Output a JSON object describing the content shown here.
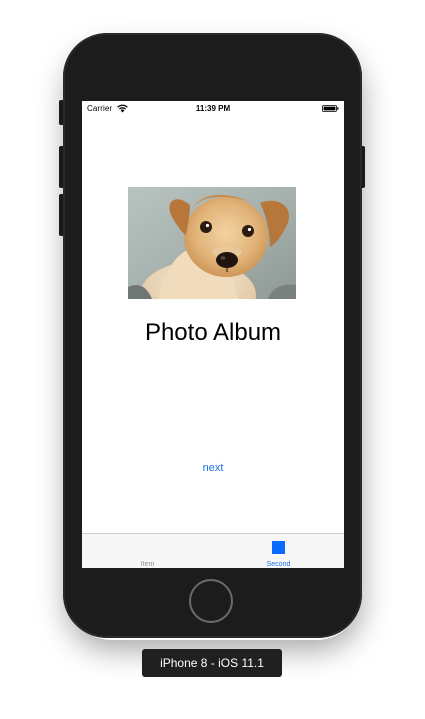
{
  "device": {
    "label": "iPhone 8 - iOS 11.1"
  },
  "status_bar": {
    "carrier": "Carrier",
    "time": "11:39 PM",
    "wifi_icon": "wifi-icon",
    "battery_icon": "battery-icon"
  },
  "main": {
    "image_icon": "puppy-photo",
    "title": "Photo Album",
    "next_label": "next"
  },
  "tab_bar": {
    "tabs": [
      {
        "label": "Item",
        "selected": false,
        "icon": "none"
      },
      {
        "label": "Second",
        "selected": true,
        "icon": "square-icon"
      }
    ]
  },
  "colors": {
    "accent": "#1a72e8",
    "tab_inactive": "#8e8e93",
    "tab_selected_icon": "#0a6cff"
  }
}
